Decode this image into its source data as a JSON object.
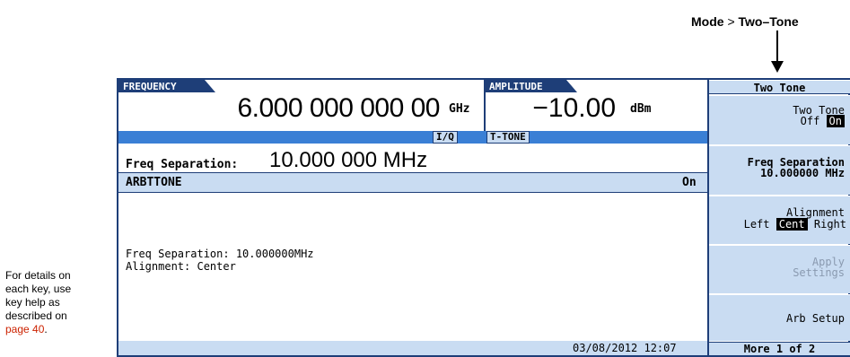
{
  "annotation": {
    "menu_key": "Mode",
    "menu_sep": ">",
    "menu_item": "Two–Tone",
    "note_line1": "For details on",
    "note_line2": "each key, use",
    "note_line3": "key help as",
    "note_line4": "described on",
    "note_link": "page 40",
    "note_tail": "."
  },
  "header": {
    "frequency_label": "FREQUENCY",
    "frequency_value": "6.000 000 000 00",
    "frequency_unit": "GHz",
    "amplitude_label": "AMPLITUDE",
    "amplitude_value": "−10.00",
    "amplitude_unit": "dBm",
    "tag_iq": "I/Q",
    "tag_ttone": "T-TONE"
  },
  "main": {
    "freq_sep_label": "Freq Separation:",
    "freq_sep_value": "10.000 000 MHz",
    "arb_title": "ARBTTONE",
    "arb_state": "On",
    "info_line1": "Freq Separation: 10.000000MHz",
    "info_line2": "Alignment: Center",
    "datetime": "03/08/2012 12:07"
  },
  "softkeys": {
    "title": "Two Tone",
    "two_tone": {
      "line1": "Two Tone",
      "off": "Off",
      "on": "On"
    },
    "freq_sep": {
      "line1": "Freq Separation",
      "line2": "10.000000 MHz"
    },
    "alignment": {
      "line1": "Alignment",
      "left": "Left",
      "cent": "Cent",
      "right": "Right"
    },
    "apply": {
      "line1": "Apply",
      "line2": "Settings"
    },
    "arb_setup": "Arb Setup",
    "more": "More 1 of 2"
  },
  "colors": {
    "frame": "#1e3e78",
    "panel": "#c9dcf2",
    "bar": "#3a7fd5",
    "link": "#cc2200"
  }
}
